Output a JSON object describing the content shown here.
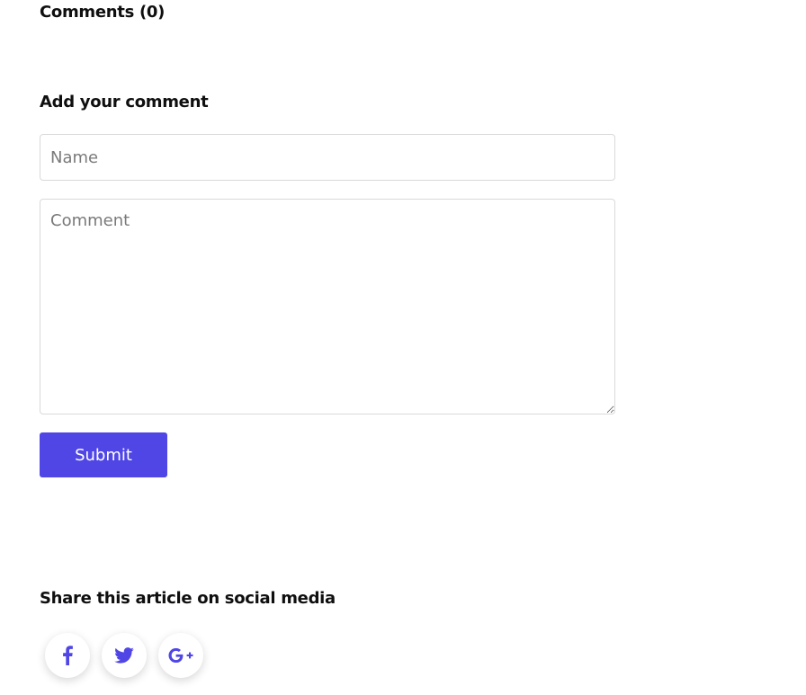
{
  "comments": {
    "heading": "Comments (0)"
  },
  "comment_form": {
    "heading": "Add your comment",
    "name_placeholder": "Name",
    "comment_placeholder": "Comment",
    "submit_label": "Submit"
  },
  "share": {
    "heading": "Share this article on social media",
    "buttons": [
      {
        "icon": "facebook-icon"
      },
      {
        "icon": "twitter-icon"
      },
      {
        "icon": "google-plus-icon"
      }
    ]
  },
  "colors": {
    "accent": "#4f46e5",
    "text": "#0f0f0f",
    "border": "#d9d9d9",
    "placeholder": "#7a7a7a"
  }
}
